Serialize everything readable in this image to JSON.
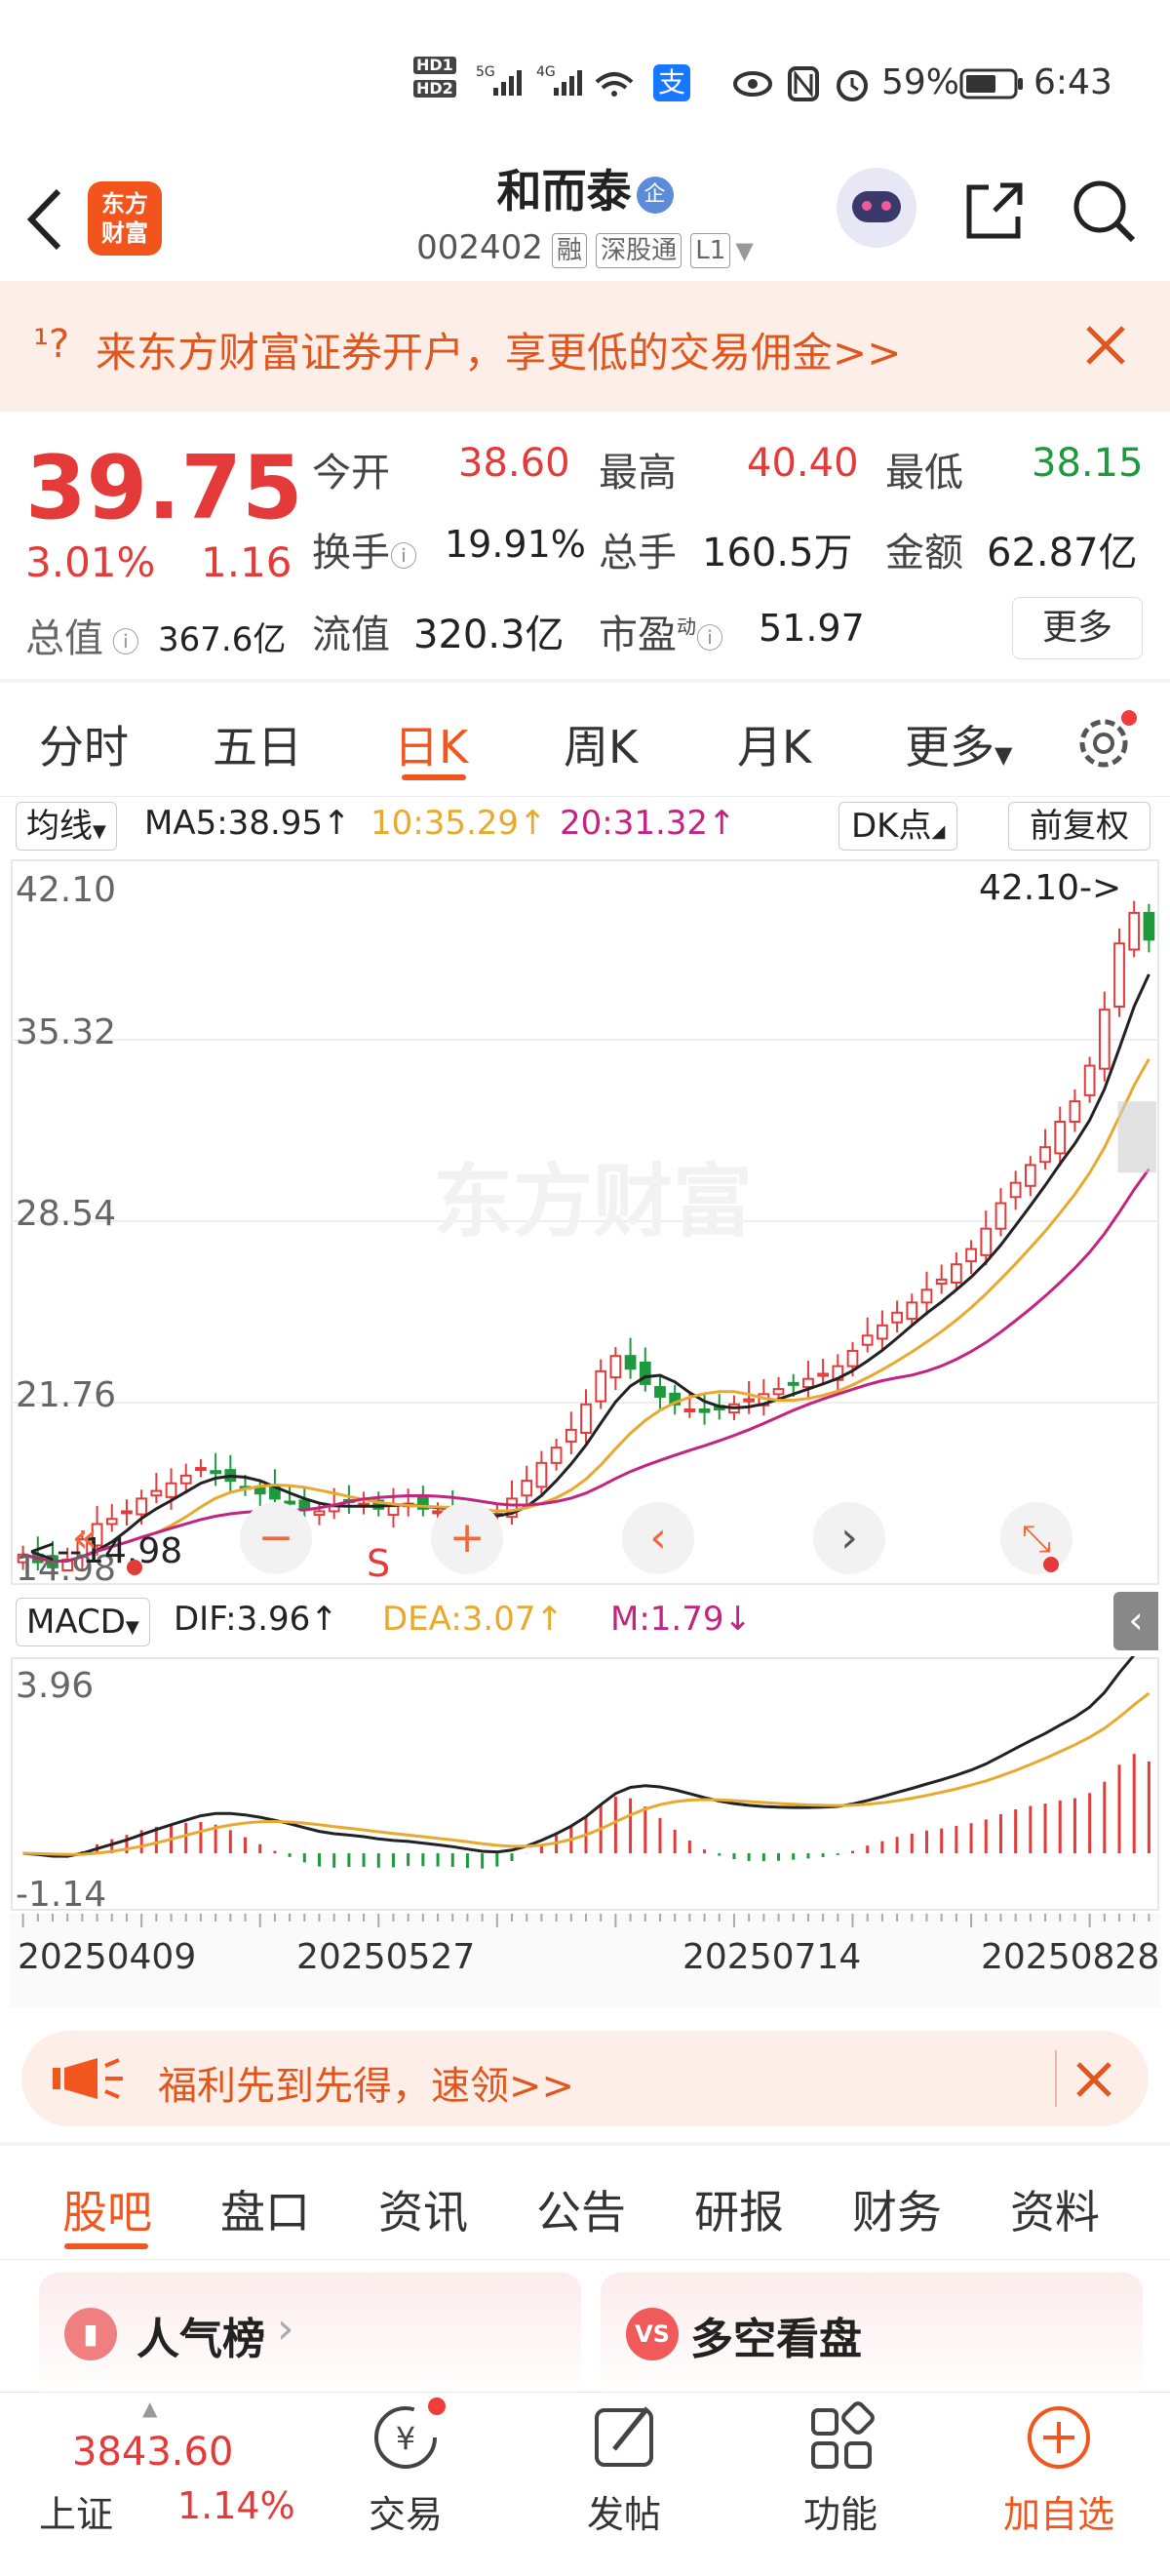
{
  "status_bar": {
    "sim1": "HD1",
    "sim2": "HD2",
    "net1": "5G",
    "net2": "4G",
    "pay_icon": "支",
    "battery": "59%",
    "time": "6:43"
  },
  "header": {
    "app_logo_line1": "东方",
    "app_logo_line2": "财富",
    "stock_name": "和而泰",
    "name_badge": "企",
    "stock_code": "002402",
    "tags": [
      "融",
      "深股通",
      "L1"
    ]
  },
  "banner": {
    "icon_text": "¹?",
    "text": "来东方财富证券开户，享更低的交易佣金>>"
  },
  "quote": {
    "price": "39.75",
    "change_pct": "3.01%",
    "change": "1.16",
    "open_label": "今开",
    "open": "38.60",
    "high_label": "最高",
    "high": "40.40",
    "low_label": "最低",
    "low": "38.15",
    "turnover_label": "换手",
    "turnover": "19.91%",
    "volume_label": "总手",
    "volume": "160.5万",
    "amount_label": "金额",
    "amount": "62.87亿",
    "mktcap_label": "总值",
    "mktcap": "367.6亿",
    "float_label": "流值",
    "float": "320.3亿",
    "pe_label": "市盈",
    "pe_sup": "动",
    "pe": "51.97",
    "more_button": "更多"
  },
  "chart_tabs": {
    "items": [
      "分时",
      "五日",
      "日K",
      "周K",
      "月K",
      "更多"
    ],
    "active": "日K"
  },
  "ma_bar": {
    "selector": "均线",
    "ma5": "MA5:38.95",
    "ma10": "10:35.29",
    "ma20": "20:31.32",
    "dk_button": "DK点",
    "adjust_button": "前复权"
  },
  "kline": {
    "y_labels": [
      "42.10",
      "35.32",
      "28.54",
      "21.76",
      "14.98"
    ],
    "max_marker": "42.10->",
    "min_marker": "<--14.98",
    "watermark": "东方财富",
    "sell_marker": "S"
  },
  "macd_bar": {
    "selector": "MACD",
    "dif": "DIF:3.96",
    "dea": "DEA:3.07",
    "m": "M:1.79"
  },
  "macd": {
    "top_label": "3.96",
    "bottom_label": "-1.14",
    "dates": [
      "20250409",
      "20250527",
      "20250714",
      "20250828"
    ]
  },
  "promo": {
    "text": "福利先到先得，速领>>"
  },
  "bottom_tabs": {
    "items": [
      "股吧",
      "盘口",
      "资讯",
      "公告",
      "研报",
      "财务",
      "资料"
    ],
    "active": "股吧"
  },
  "cards": {
    "left_title": "人气榜",
    "right_title": "多空看盘",
    "right_badge": "VS"
  },
  "footer": {
    "index_value": "3843.60",
    "index_name": "上证",
    "index_change": "1.14%",
    "nav": [
      "交易",
      "发帖",
      "功能",
      "加自选"
    ]
  },
  "chart_data": {
    "type": "candlestick",
    "ylim": [
      14.98,
      42.1
    ],
    "x_ticks": [
      "20250409",
      "20250527",
      "20250714",
      "20250828"
    ],
    "close": [
      15.6,
      15.3,
      15.1,
      15.4,
      16.2,
      16.8,
      17.0,
      17.3,
      17.8,
      18.1,
      18.4,
      18.7,
      19.0,
      18.8,
      18.5,
      18.2,
      18.0,
      17.8,
      17.6,
      17.4,
      17.3,
      17.5,
      17.7,
      17.6,
      17.4,
      17.5,
      17.6,
      17.4,
      17.3,
      17.2,
      17.0,
      16.9,
      17.2,
      17.8,
      18.5,
      19.2,
      19.8,
      20.5,
      21.5,
      22.8,
      23.4,
      22.9,
      22.3,
      21.8,
      21.5,
      21.3,
      21.2,
      21.3,
      21.5,
      21.7,
      21.9,
      22.1,
      22.3,
      22.5,
      22.7,
      23.0,
      23.6,
      24.2,
      24.6,
      25.1,
      25.5,
      26.0,
      26.4,
      27.0,
      27.6,
      28.4,
      29.4,
      30.2,
      30.9,
      31.6,
      32.6,
      33.4,
      34.8,
      37.0,
      39.6,
      40.8,
      39.75
    ],
    "ma5_last": 38.95,
    "ma10_last": 35.29,
    "ma20_last": 31.32,
    "macd_dif_last": 3.96,
    "macd_dea_last": 3.07,
    "macd_m_last": 1.79,
    "macd_ylim": [
      -1.14,
      3.96
    ]
  }
}
